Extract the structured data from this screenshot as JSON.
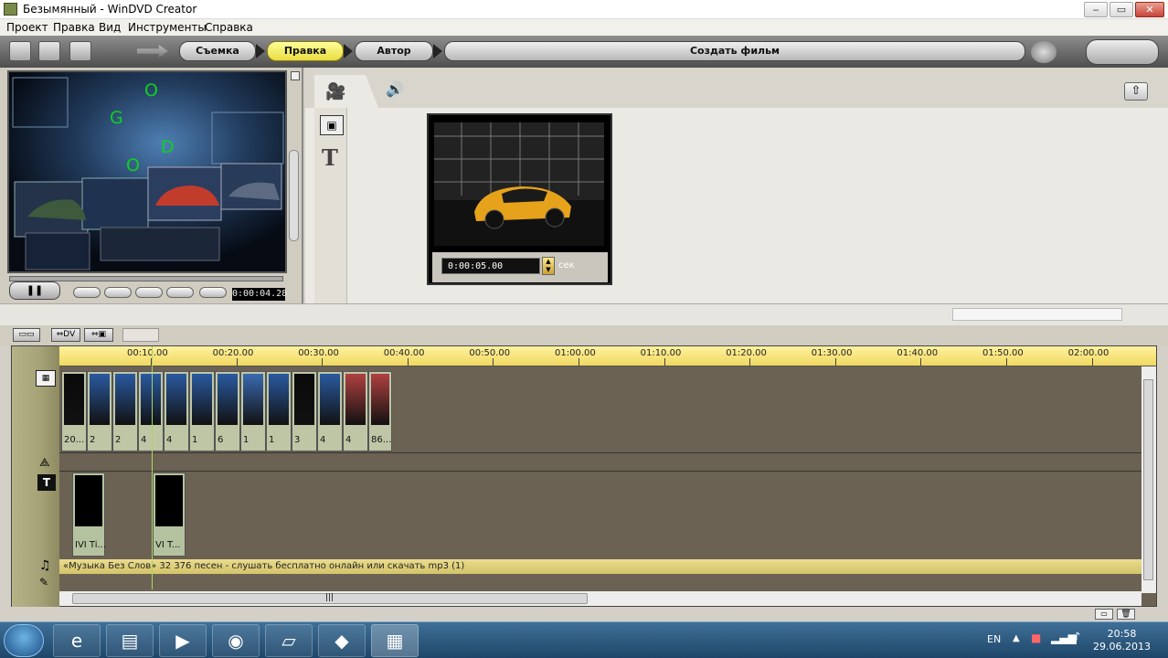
{
  "window": {
    "title": "Безымянный - WinDVD Creator",
    "controls": {
      "minimize": "‒",
      "maximize": "▭",
      "close": "✕"
    }
  },
  "menu": [
    "Проект",
    "Правка",
    "Вид",
    "Инструменты",
    "Справка"
  ],
  "workflow": {
    "steps": [
      "Съемка",
      "Правка",
      "Автор"
    ],
    "active": "Правка",
    "create_label": "Создать фильм"
  },
  "preview": {
    "overlay_letters": [
      "O",
      "G",
      "D",
      "O"
    ],
    "timecode": "0:00:04.28"
  },
  "editor": {
    "clip_duration": "0:00:05.00",
    "duration_unit": "сек"
  },
  "timeline": {
    "toolbar": [
      "⇔DV",
      "⇔▣"
    ],
    "ruler_labels": [
      "00:10.00",
      "00:20.00",
      "00:30.00",
      "00:40.00",
      "00:50.00",
      "01:00.00",
      "01:10.00",
      "01:20.00",
      "01:30.00",
      "01:40.00",
      "01:50.00",
      "02:00.00"
    ],
    "video_clip_labels": [
      "20...",
      "2",
      "2",
      "4",
      "4",
      "1",
      "6",
      "1",
      "1",
      "3",
      "4",
      "4",
      "86..."
    ],
    "title_clip_labels": [
      "IVI Ti...",
      "VI T..."
    ],
    "audio_label": "«Музыка Без Слов» 32 376 песен - слушать бесплатно онлайн или скачать mp3 (1)",
    "scroll_grip": "|||"
  },
  "taskbar": {
    "language": "EN",
    "time": "20:58",
    "date": "29.06.2013"
  }
}
